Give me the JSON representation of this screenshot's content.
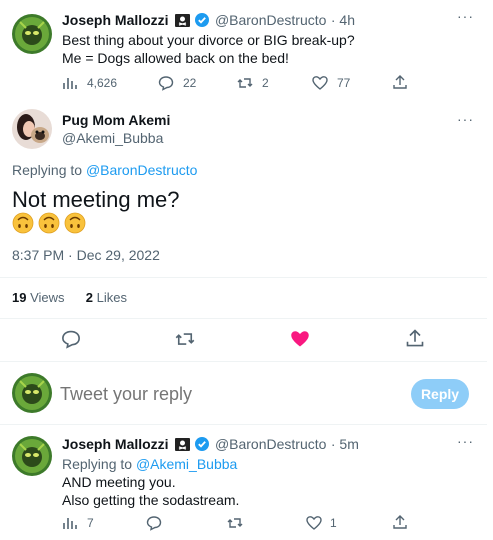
{
  "tweet1": {
    "name": "Joseph Mallozzi",
    "handle": "@BaronDestructo",
    "time": "· 4h",
    "line1": "Best thing about your divorce or BIG break-up?",
    "line2": "Me = Dogs allowed back on the bed!",
    "views": "4,626",
    "replies": "22",
    "retweets": "2",
    "likes": "77"
  },
  "main": {
    "name": "Pug Mom Akemi",
    "handle": "@Akemi_Bubba",
    "replying_prefix": "Replying to",
    "replying_to": "@BaronDestructo",
    "text": "Not meeting me?",
    "emojis": [
      "upside-down-face",
      "upside-down-face",
      "upside-down-face"
    ],
    "timestamp": "8:37 PM · Dec 29, 2022",
    "views_count": "19",
    "views_label": "Views",
    "likes_count": "2",
    "likes_label": "Likes"
  },
  "compose": {
    "placeholder": "Tweet your reply",
    "button": "Reply"
  },
  "tweet2": {
    "name": "Joseph Mallozzi",
    "handle": "@BaronDestructo",
    "time": "· 5m",
    "replying_prefix": "Replying to",
    "replying_to": "@Akemi_Bubba",
    "line1": "AND meeting you.",
    "line2": "Also getting the sodastream.",
    "views": "7",
    "likes": "1"
  },
  "colors": {
    "accent": "#1d9bf0",
    "like_active": "#f91880",
    "verified": "#1d9bf0",
    "reply_button": "#8ecdf8"
  }
}
